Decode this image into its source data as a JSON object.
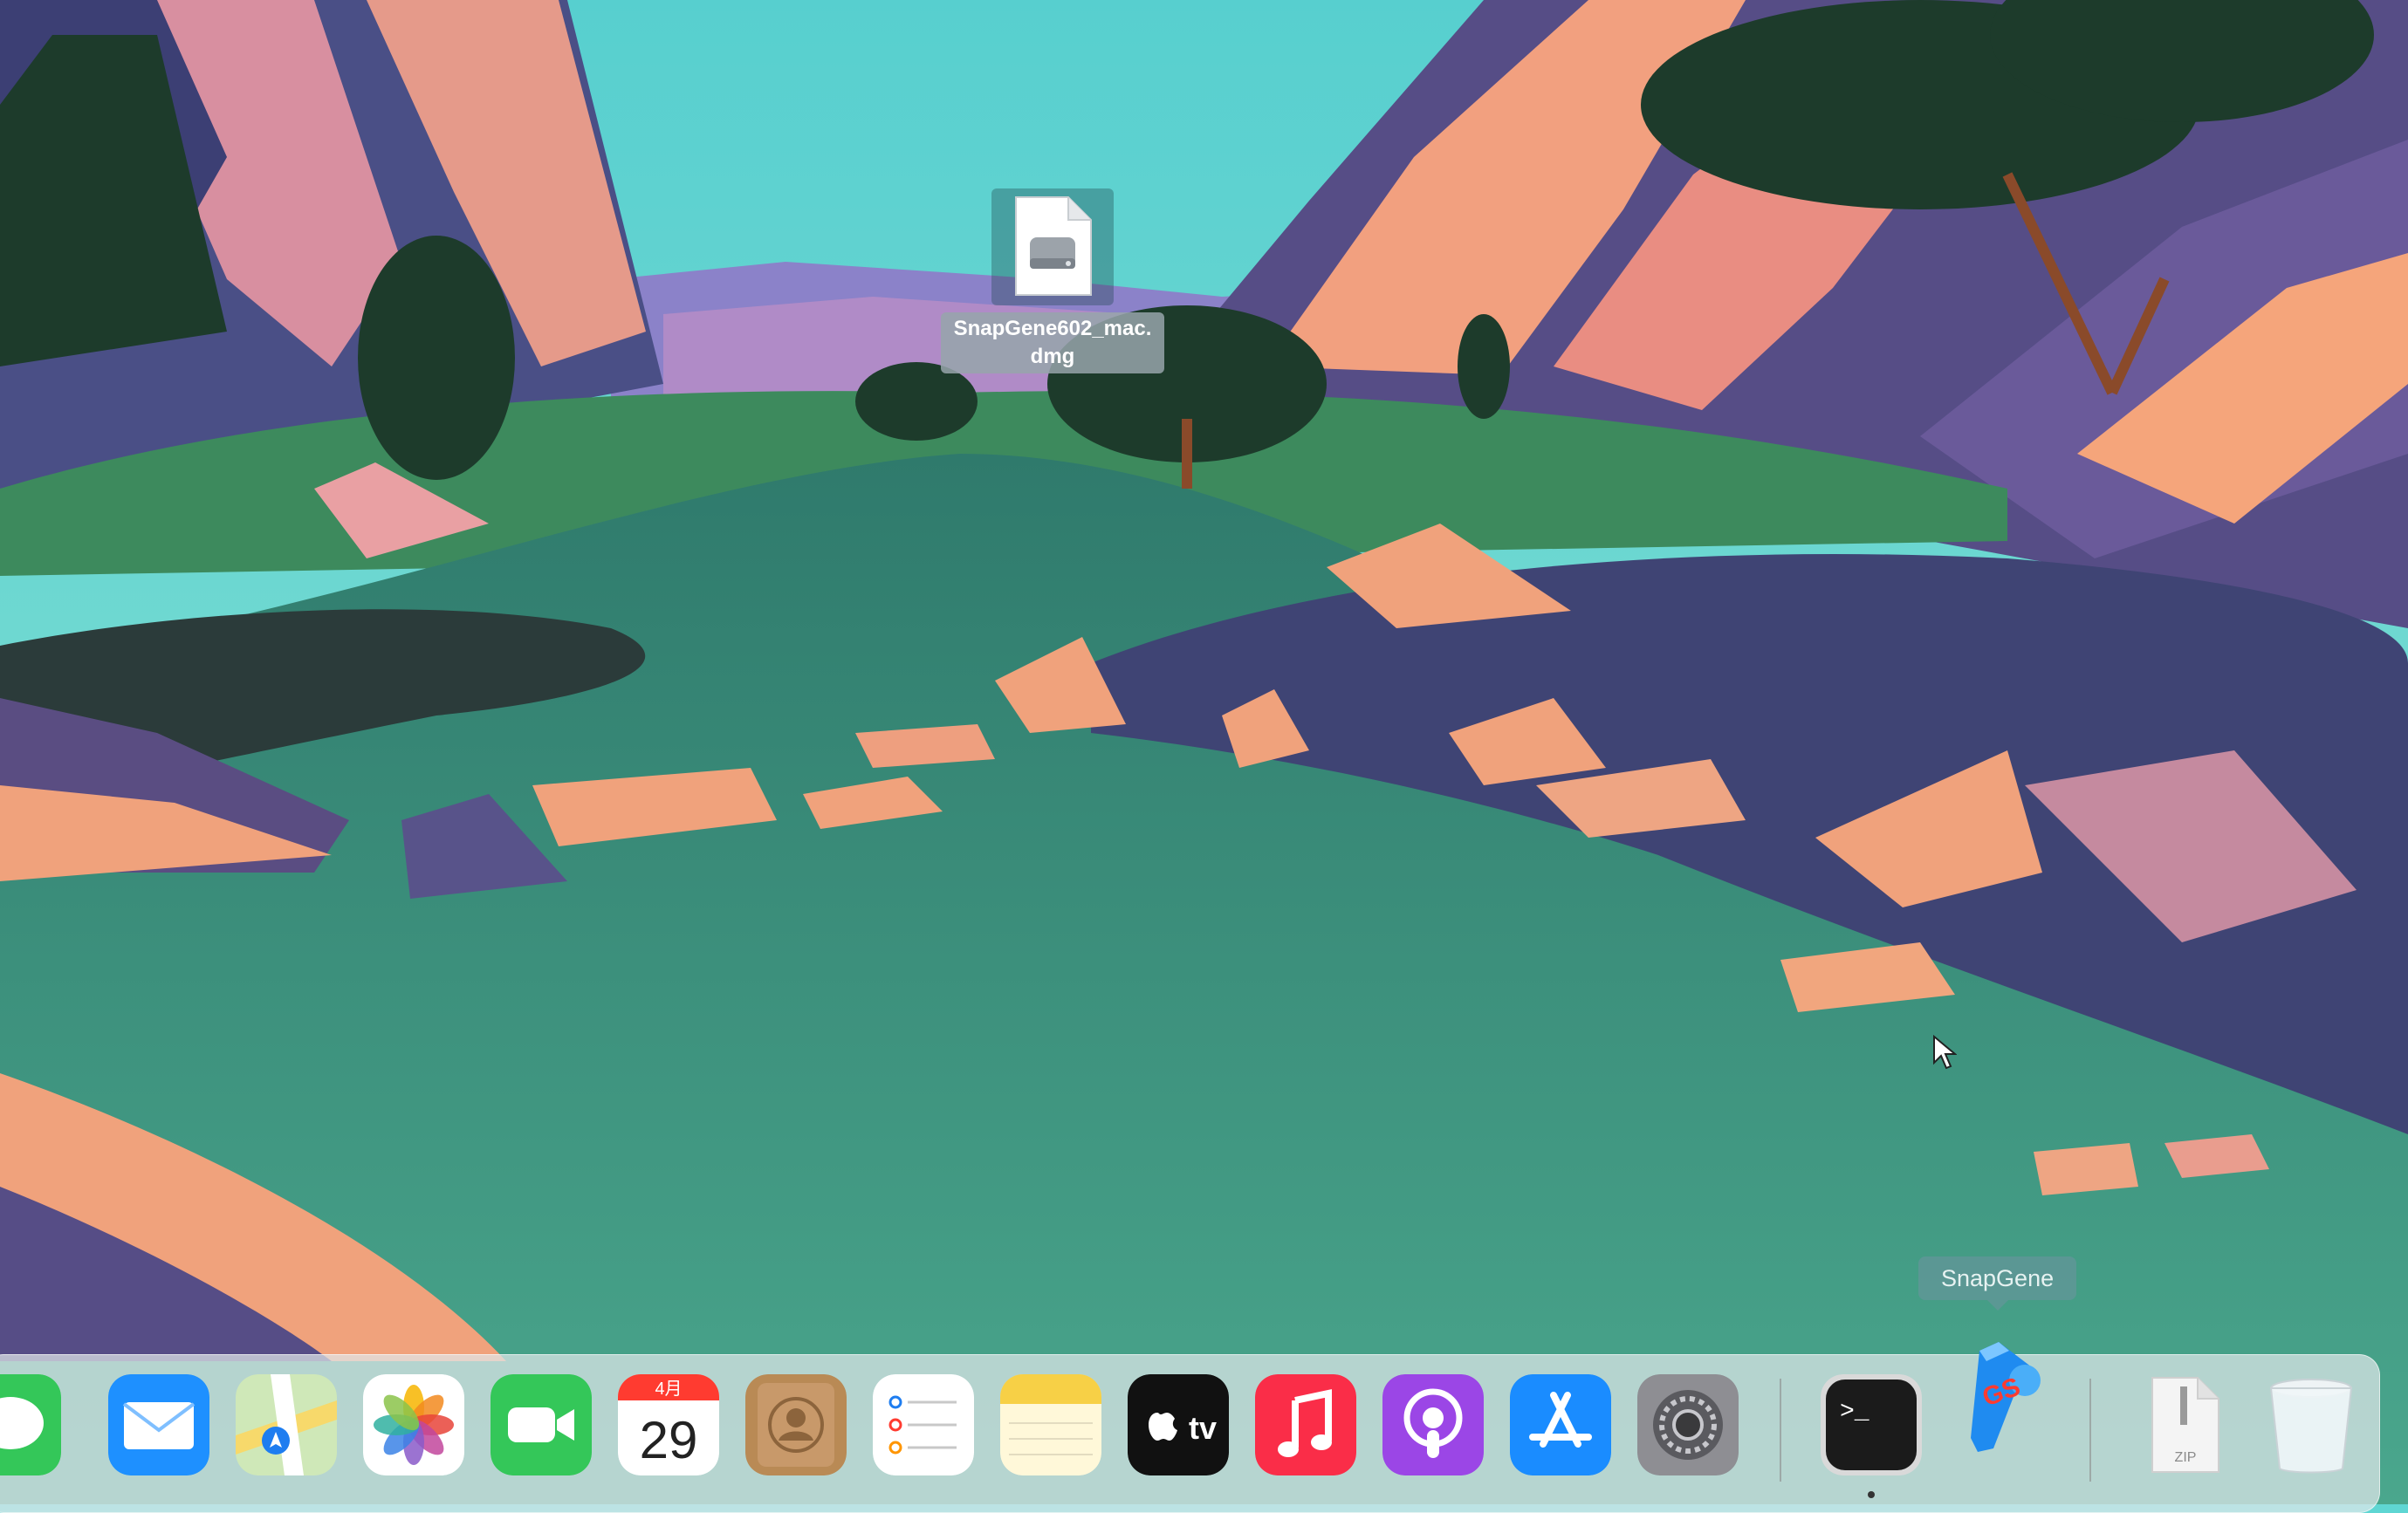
{
  "desktop": {
    "file": {
      "name": "SnapGene602_mac.dmg",
      "icon": "disk-image-icon"
    },
    "tooltip": "SnapGene"
  },
  "dock": {
    "apps": [
      {
        "name": "Messages",
        "icon": "messages-icon"
      },
      {
        "name": "Mail",
        "icon": "mail-icon"
      },
      {
        "name": "Maps",
        "icon": "maps-icon"
      },
      {
        "name": "Photos",
        "icon": "photos-icon"
      },
      {
        "name": "FaceTime",
        "icon": "facetime-icon"
      },
      {
        "name": "Calendar",
        "icon": "calendar-icon",
        "month": "4月",
        "day": "29"
      },
      {
        "name": "Contacts",
        "icon": "contacts-icon"
      },
      {
        "name": "Reminders",
        "icon": "reminders-icon"
      },
      {
        "name": "Notes",
        "icon": "notes-icon"
      },
      {
        "name": "TV",
        "icon": "apple-tv-icon",
        "label": "tv"
      },
      {
        "name": "Music",
        "icon": "music-icon"
      },
      {
        "name": "Podcasts",
        "icon": "podcasts-icon"
      },
      {
        "name": "App Store",
        "icon": "app-store-icon"
      },
      {
        "name": "System Preferences",
        "icon": "system-preferences-icon"
      },
      {
        "name": "Terminal",
        "icon": "terminal-icon",
        "label": ">_",
        "running": true
      },
      {
        "name": "SnapGene",
        "icon": "snapgene-icon",
        "label": "GS"
      },
      {
        "name": "ZIP Archive",
        "icon": "zip-archive-icon",
        "label": "ZIP"
      },
      {
        "name": "Trash",
        "icon": "trash-icon"
      }
    ]
  },
  "colors": {
    "sky": "#5fd6d3",
    "water": "#3f9a84",
    "rock_light": "#f0a27c",
    "rock_dark": "#4a4874",
    "dock": "#e1e8ea"
  }
}
